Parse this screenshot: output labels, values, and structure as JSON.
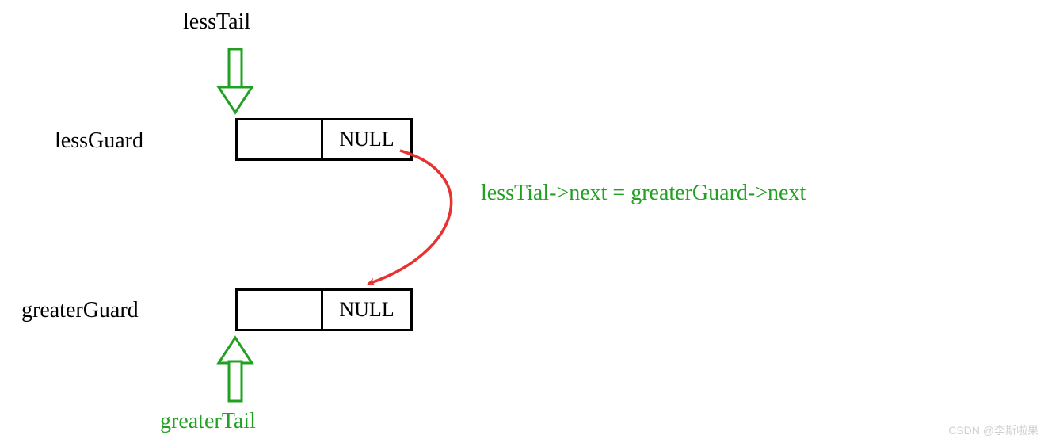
{
  "labels": {
    "lessTail": "lessTail",
    "lessGuard": "lessGuard",
    "greaterGuard": "greaterGuard",
    "greaterTail": "greaterTail",
    "assignment": "lessTial->next = greaterGuard->next"
  },
  "nodes": {
    "less": {
      "next": "NULL"
    },
    "greater": {
      "next": "NULL"
    }
  },
  "colors": {
    "green": "#22a022",
    "red": "#e83131",
    "black": "#000000"
  },
  "watermark": "CSDN @李斯啦果"
}
